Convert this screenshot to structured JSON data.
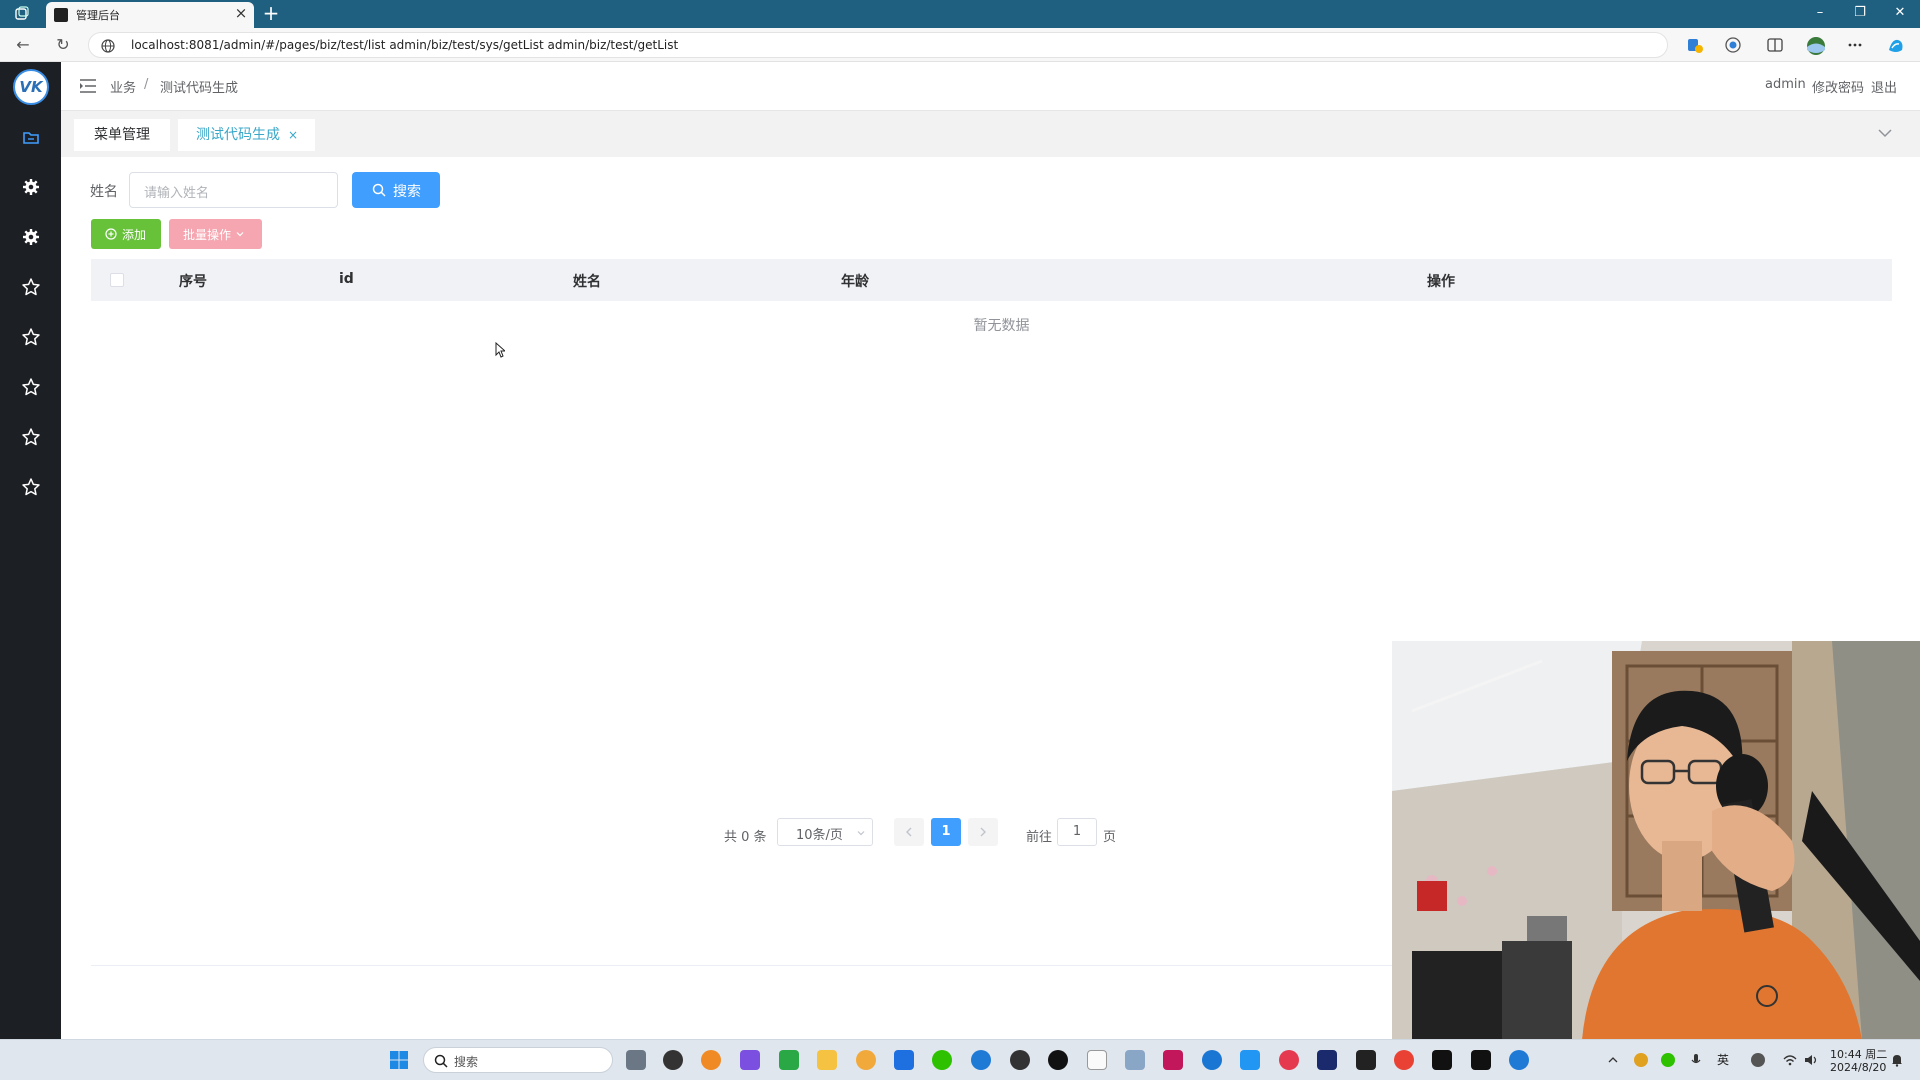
{
  "browser": {
    "tab_title": "管理后台",
    "tab_close": "×",
    "new_tab": "+",
    "url": "localhost:8081/admin/#/pages/biz/test/list   admin/biz/test/sys/getList admin/biz/test/getList",
    "window_controls": {
      "minimize": "–",
      "restore": "❐",
      "close": "✕"
    },
    "nav": {
      "back": "←",
      "reload": "↻"
    }
  },
  "app": {
    "logo": "VK",
    "breadcrumb": [
      "业务",
      "测试代码生成"
    ],
    "breadcrumb_sep": "/",
    "top_links": {
      "user": "admin",
      "change_password": "修改密码",
      "logout": "退出"
    },
    "sidebar_icons": [
      "folder-icon",
      "gear-icon",
      "gear-icon",
      "star-icon",
      "star-icon",
      "star-icon",
      "star-icon",
      "star-icon"
    ],
    "tabs": [
      {
        "label": "菜单管理",
        "active": false
      },
      {
        "label": "测试代码生成",
        "active": true,
        "close": "×"
      }
    ]
  },
  "search": {
    "name_label": "姓名",
    "name_placeholder": "请输入姓名",
    "search_button": "搜索"
  },
  "actions": {
    "add_button": "添加",
    "batch_button": "批量操作"
  },
  "table": {
    "columns": [
      "序号",
      "id",
      "姓名",
      "年龄",
      "操作"
    ],
    "rows": [],
    "empty_text": "暂无数据"
  },
  "pagination": {
    "total": "共 0 条",
    "page_size": "10条/页",
    "current_page": "1",
    "goto_label": "前往",
    "goto_value": "1",
    "goto_suffix": "页"
  },
  "taskbar": {
    "search_label": "搜索",
    "lang": "英",
    "time": "10:44 周二",
    "date": "2024/8/20"
  },
  "colors": {
    "primary": "#409eff",
    "success": "#67c23a",
    "danger_light": "#f5a6b0",
    "sidebar_bg": "#1c1f24",
    "active_tab_text": "#3aa7c9"
  }
}
